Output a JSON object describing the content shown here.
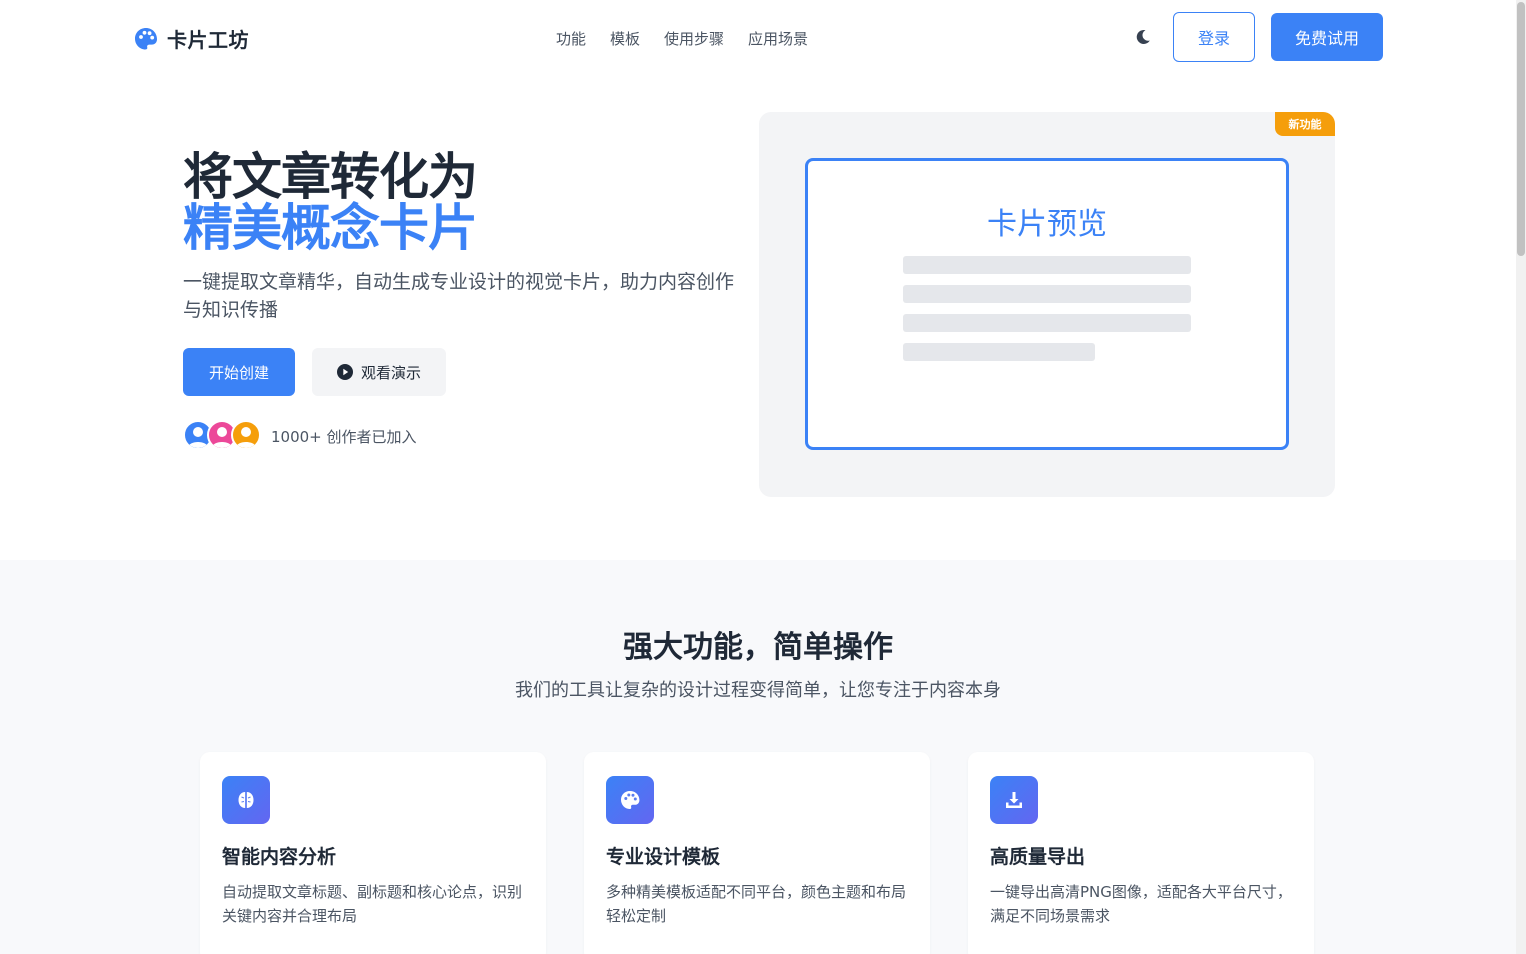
{
  "header": {
    "brand": "卡片工坊",
    "nav": [
      "功能",
      "模板",
      "使用步骤",
      "应用场景"
    ],
    "login_label": "登录",
    "trial_label": "免费试用"
  },
  "hero": {
    "title_line1": "将文章转化为",
    "title_line2": "精美概念卡片",
    "subtitle": "一键提取文章精华，自动生成专业设计的视觉卡片，助力内容创作与知识传播",
    "start_label": "开始创建",
    "demo_label": "观看演示",
    "joined_text": "1000+ 创作者已加入"
  },
  "preview": {
    "badge": "新功能",
    "title": "卡片预览"
  },
  "features": {
    "title": "强大功能，简单操作",
    "subtitle": "我们的工具让复杂的设计过程变得简单，让您专注于内容本身",
    "cards": [
      {
        "icon": "brain-icon",
        "title": "智能内容分析",
        "desc": "自动提取文章标题、副标题和核心论点，识别关键内容并合理布局"
      },
      {
        "icon": "palette-icon",
        "title": "专业设计模板",
        "desc": "多种精美模板适配不同平台，颜色主题和布局轻松定制"
      },
      {
        "icon": "download-icon",
        "title": "高质量导出",
        "desc": "一键导出高清PNG图像，适配各大平台尺寸，满足不同场景需求"
      }
    ]
  },
  "colors": {
    "accent": "#3b82f6",
    "badge": "#f59e0b",
    "avatar_colors": [
      "#3b82f6",
      "#ec4899",
      "#f59e0b"
    ]
  }
}
